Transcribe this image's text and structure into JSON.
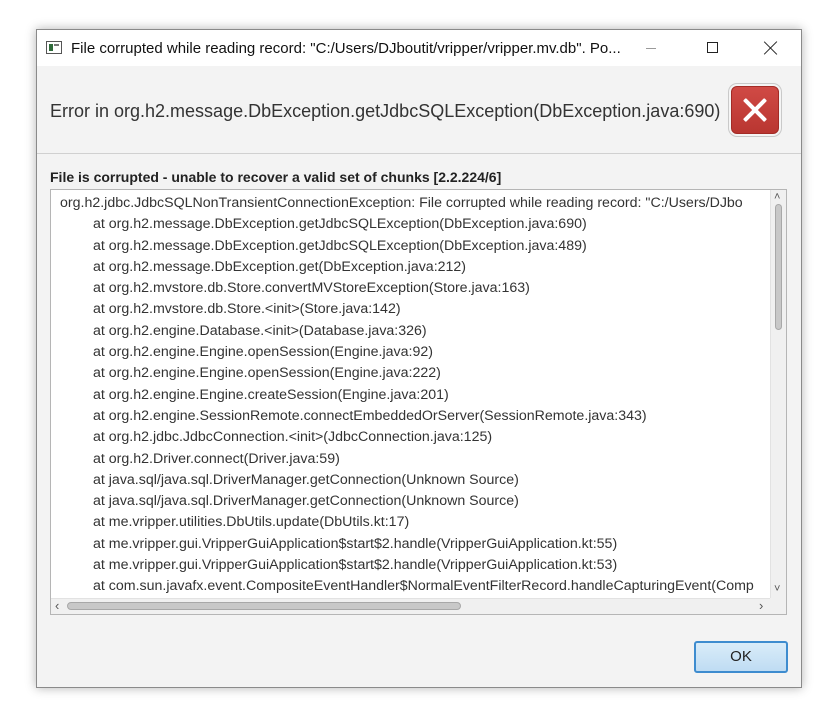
{
  "window": {
    "title": "File corrupted while reading record: \"C:/Users/DJboutit/vripper/vripper.mv.db\". Po..."
  },
  "header": {
    "text": "Error in org.h2.message.DbException.getJdbcSQLException(DbException.java:690)",
    "icon": "error-icon"
  },
  "content": {
    "label": "File is corrupted - unable to recover a valid set of chunks [2.2.224/6]",
    "trace_lines": [
      "org.h2.jdbc.JdbcSQLNonTransientConnectionException: File corrupted while reading record: \"C:/Users/DJbo",
      "at org.h2.message.DbException.getJdbcSQLException(DbException.java:690)",
      "at org.h2.message.DbException.getJdbcSQLException(DbException.java:489)",
      "at org.h2.message.DbException.get(DbException.java:212)",
      "at org.h2.mvstore.db.Store.convertMVStoreException(Store.java:163)",
      "at org.h2.mvstore.db.Store.<init>(Store.java:142)",
      "at org.h2.engine.Database.<init>(Database.java:326)",
      "at org.h2.engine.Engine.openSession(Engine.java:92)",
      "at org.h2.engine.Engine.openSession(Engine.java:222)",
      "at org.h2.engine.Engine.createSession(Engine.java:201)",
      "at org.h2.engine.SessionRemote.connectEmbeddedOrServer(SessionRemote.java:343)",
      "at org.h2.jdbc.JdbcConnection.<init>(JdbcConnection.java:125)",
      "at org.h2.Driver.connect(Driver.java:59)",
      "at java.sql/java.sql.DriverManager.getConnection(Unknown Source)",
      "at java.sql/java.sql.DriverManager.getConnection(Unknown Source)",
      "at me.vripper.utilities.DbUtils.update(DbUtils.kt:17)",
      "at me.vripper.gui.VripperGuiApplication$start$2.handle(VripperGuiApplication.kt:55)",
      "at me.vripper.gui.VripperGuiApplication$start$2.handle(VripperGuiApplication.kt:53)",
      "at com.sun.javafx.event.CompositeEventHandler$NormalEventFilterRecord.handleCapturingEvent(Comp"
    ]
  },
  "buttons": {
    "ok_label": "OK"
  },
  "scroll": {
    "up_arrow": "˄",
    "down_arrow": "˅",
    "left_arrow": "‹",
    "right_arrow": "›"
  }
}
